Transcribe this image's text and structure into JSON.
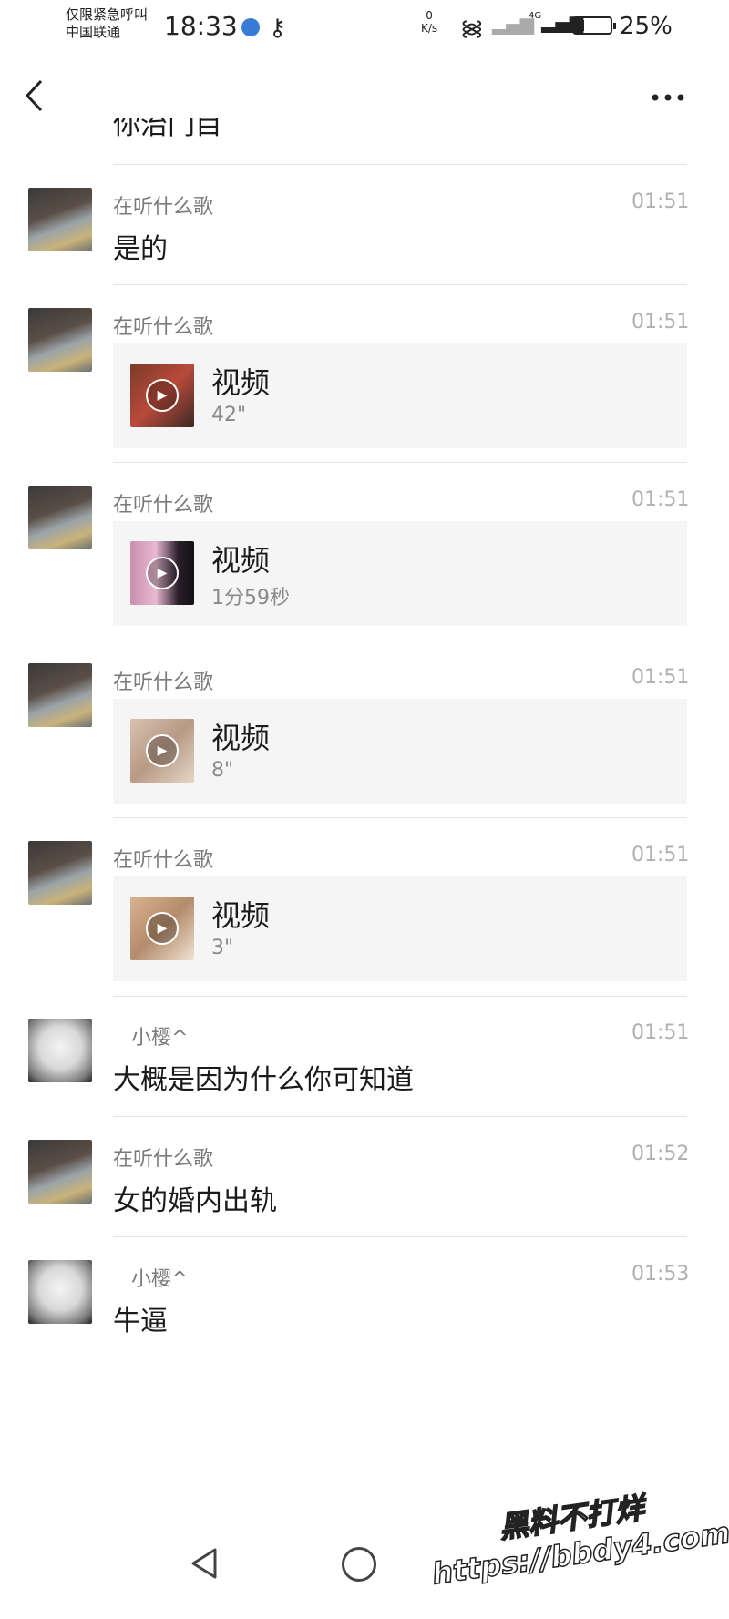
{
  "status_bar": {
    "carrier_line1": "仅限紧急呼叫",
    "carrier_line2": "中国联通",
    "time": "18:33",
    "speed_value": "0",
    "speed_unit": "K/s",
    "network_type": "4G",
    "battery_percent": "25%",
    "battery_level": 0.25
  },
  "header": {
    "back_icon": "chevron-left-icon",
    "more_icon": "more-dots-icon"
  },
  "partial_message": {
    "text": "你治门目"
  },
  "messages": [
    {
      "sender": "在听什么歌",
      "time": "01:51",
      "type": "text",
      "text": "是的"
    },
    {
      "sender": "在听什么歌",
      "time": "01:51",
      "type": "video",
      "title": "视频",
      "duration": "42\""
    },
    {
      "sender": "在听什么歌",
      "time": "01:51",
      "type": "video",
      "title": "视频",
      "duration": "1分59秒"
    },
    {
      "sender": "在听什么歌",
      "time": "01:51",
      "type": "video",
      "title": "视频",
      "duration": "8\""
    },
    {
      "sender": "在听什么歌",
      "time": "01:51",
      "type": "video",
      "title": "视频",
      "duration": "3\""
    },
    {
      "sender": "小樱^",
      "time": "01:51",
      "type": "text",
      "text": "大概是因为什么你可知道"
    },
    {
      "sender": "在听什么歌",
      "time": "01:52",
      "type": "text",
      "text": "女的婚内出轨"
    },
    {
      "sender": "小樱^",
      "time": "01:53",
      "type": "text",
      "text": "牛逼"
    }
  ],
  "navbar": {
    "back_icon": "triangle-back-icon",
    "home_icon": "circle-home-icon"
  },
  "watermark": {
    "line1": "黑料不打烊",
    "line2": "https://bbdy4.com"
  }
}
